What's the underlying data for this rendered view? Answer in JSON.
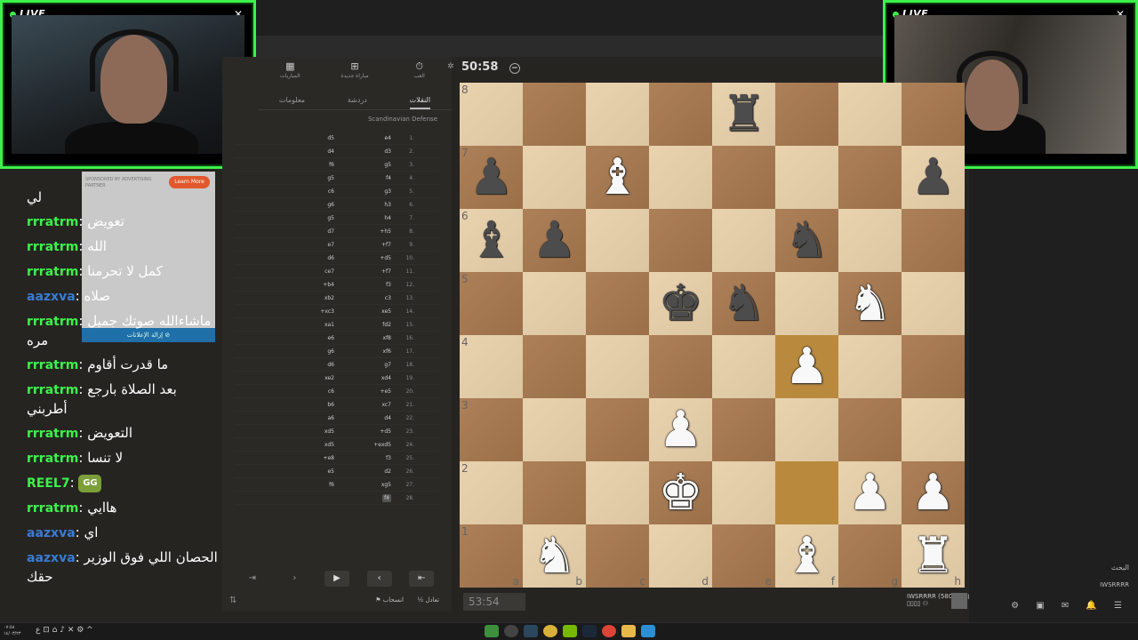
{
  "overlay": {
    "live_label": "LIVE",
    "close_glyph": "✕"
  },
  "ad": {
    "sponsored": "SPONSORED BY ADVERTISING PARTNER",
    "learn_more": "Learn More",
    "remove_ads": "إزالة الإعلانات ⊘"
  },
  "chat": {
    "messages": [
      {
        "user": "",
        "sep": "",
        "text": "لي",
        "color": "green"
      },
      {
        "user": "rrratrm",
        "sep": ":",
        "text": "تعويض",
        "color": "green"
      },
      {
        "user": "rrratrm",
        "sep": ":",
        "text": "الله",
        "color": "green"
      },
      {
        "user": "rrratrm",
        "sep": ":",
        "text": "كمل لا تحرمنا",
        "color": "green"
      },
      {
        "user": "aazxva",
        "sep": ":",
        "text": "صلاه",
        "color": "blue"
      },
      {
        "user": "rrratrm",
        "sep": ":",
        "text": "ماشاءالله صوتك جميل مره",
        "color": "green"
      },
      {
        "user": "rrratrm",
        "sep": ":",
        "text": "ما قدرت أقاوم",
        "color": "green"
      },
      {
        "user": "rrratrm",
        "sep": ":",
        "text": "بعد الصلاة بارجع أطربني",
        "color": "green"
      },
      {
        "user": "rrratrm",
        "sep": ":",
        "text": "التعويض",
        "color": "green"
      },
      {
        "user": "rrratrm",
        "sep": ":",
        "text": "لا تنسا",
        "color": "green"
      },
      {
        "user": "REEL7",
        "sep": ":",
        "text": "",
        "emote": "GG",
        "color": "green"
      },
      {
        "user": "rrratrm",
        "sep": ":",
        "text": "هاايي",
        "color": "green"
      },
      {
        "user": "aazxva",
        "sep": ":",
        "text": "اي",
        "color": "blue"
      },
      {
        "user": "aazxva",
        "sep": ":",
        "text": "الحصان اللي فوق الوزير حقك",
        "color": "blue"
      }
    ]
  },
  "lichess": {
    "tools": [
      {
        "icon": "▦",
        "label": "المباريات"
      },
      {
        "icon": "⊞",
        "label": "مباراة جديدة"
      },
      {
        "icon": "⏱",
        "label": "العب"
      }
    ],
    "tabs": [
      {
        "label": "معلومات",
        "active": false
      },
      {
        "label": "دردشة",
        "active": false
      },
      {
        "label": "النقلات",
        "active": true
      }
    ],
    "opening": "Scandinavian Defense",
    "moves": [
      {
        "n": "1.",
        "w": "e4",
        "b": "d5"
      },
      {
        "n": "2.",
        "w": "d3",
        "b": "d4"
      },
      {
        "n": "3.",
        "w": "g5",
        "b": "f6"
      },
      {
        "n": "4.",
        "w": "f4",
        "b": "g5"
      },
      {
        "n": "5.",
        "w": "g3",
        "b": "c6"
      },
      {
        "n": "6.",
        "w": "h3",
        "b": "g6"
      },
      {
        "n": "7.",
        "w": "h4",
        "b": "g5"
      },
      {
        "n": "8.",
        "w": "+h5",
        "b": "d7"
      },
      {
        "n": "9.",
        "w": "+f7",
        "b": "e7"
      },
      {
        "n": "10.",
        "w": "+d5",
        "b": "d6"
      },
      {
        "n": "11.",
        "w": "+f7",
        "b": "ce7"
      },
      {
        "n": "12.",
        "w": "f3",
        "b": "+b4"
      },
      {
        "n": "13.",
        "w": "c3",
        "b": "xb2"
      },
      {
        "n": "14.",
        "w": "xe5",
        "b": "+xc3"
      },
      {
        "n": "15.",
        "w": "fd2",
        "b": "xa1"
      },
      {
        "n": "16.",
        "w": "xf8",
        "b": "e6"
      },
      {
        "n": "17.",
        "w": "xf6",
        "b": "g6"
      },
      {
        "n": "18.",
        "w": "g7",
        "b": "d6"
      },
      {
        "n": "19.",
        "w": "xd4",
        "b": "xe2"
      },
      {
        "n": "20.",
        "w": "+e5",
        "b": "c6"
      },
      {
        "n": "21.",
        "w": "xc7",
        "b": "b6"
      },
      {
        "n": "22.",
        "w": "d4",
        "b": "a6"
      },
      {
        "n": "23.",
        "w": "+d5",
        "b": "xd5"
      },
      {
        "n": "24.",
        "w": "+exd5",
        "b": "xd5"
      },
      {
        "n": "25.",
        "w": "f3",
        "b": "+e8"
      },
      {
        "n": "26.",
        "w": "d2",
        "b": "e5"
      },
      {
        "n": "27.",
        "w": "xg5",
        "b": "f6"
      },
      {
        "n": "28.",
        "w": "f4",
        "b": ""
      }
    ],
    "nav": {
      "last": "⇥",
      "next": "›",
      "play": "▶",
      "prev": "‹",
      "first": "⇤"
    },
    "flip": "⇅",
    "resign": "⚑ انسحاب",
    "draw": "½ تعادل"
  },
  "clock": {
    "top": "50:58",
    "bottom": "53:54",
    "minus": "−",
    "settings_icon": "✲"
  },
  "players": {
    "bottom_name": "IWSRRRR (580) ▬ ▮▮▮▮",
    "bottom_sub": "▯▯▯▯ ⚇"
  },
  "board": {
    "ranks": [
      "8",
      "7",
      "6",
      "5",
      "4",
      "3",
      "2",
      "1"
    ],
    "files": [
      "a",
      "b",
      "c",
      "d",
      "e",
      "f",
      "g",
      "h"
    ],
    "highlight": [
      "f4",
      "f2"
    ],
    "pieces": {
      "e8": "br",
      "h7": "bp",
      "a7": "bp",
      "c7": "wb",
      "a6": "bb",
      "b6": "bp",
      "f6": "bn",
      "d5": "bk",
      "e5": "bn",
      "g5": "wn",
      "f4": "wp",
      "d3": "wp",
      "d2": "wk",
      "g2": "wp",
      "h2": "wp",
      "b1": "wn",
      "f1": "wb",
      "h1": "wr"
    }
  },
  "sidebar": {
    "search": "البحث",
    "user": "IWSRRRR",
    "icons": "⚙ ▣ ✉ 🔔 ☰"
  },
  "taskbar": {
    "time": "٠٧:٥٨",
    "date": "١٤/٠٣/٢٣",
    "tray": "ع ⊡ ⌂ ♪ ✕ ⚙ ^"
  }
}
